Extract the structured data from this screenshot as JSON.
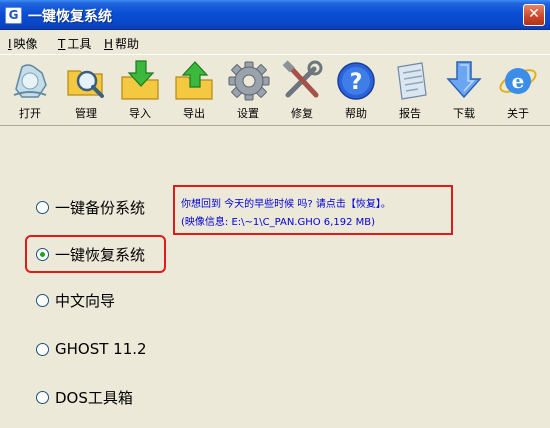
{
  "window": {
    "icon_letter": "G",
    "title": "一键恢复系统",
    "close_glyph": "✕"
  },
  "menu": [
    {
      "key": "I",
      "label": "映像"
    },
    {
      "key": "T",
      "label": "工具"
    },
    {
      "key": "H",
      "label": "帮助"
    }
  ],
  "toolbar": [
    {
      "label": "打开",
      "icon": "open-icon"
    },
    {
      "label": "管理",
      "icon": "manage-icon"
    },
    {
      "label": "导入",
      "icon": "import-icon"
    },
    {
      "label": "导出",
      "icon": "export-icon"
    },
    {
      "label": "设置",
      "icon": "settings-icon"
    },
    {
      "label": "修复",
      "icon": "repair-icon"
    },
    {
      "label": "帮助",
      "icon": "help-icon"
    },
    {
      "label": "报告",
      "icon": "report-icon"
    },
    {
      "label": "下载",
      "icon": "download-icon"
    },
    {
      "label": "关于",
      "icon": "about-icon"
    }
  ],
  "options": [
    {
      "label": "一键备份系统",
      "checked": false
    },
    {
      "label": "一键恢复系统",
      "checked": true
    },
    {
      "label": "中文向导",
      "checked": false
    },
    {
      "label": "GHOST 11.2",
      "checked": false
    },
    {
      "label": "DOS工具箱",
      "checked": false
    }
  ],
  "info": {
    "line1": "你想回到 今天的早些时候 吗? 请点击【恢复】。",
    "line2": "(映像信息: E:\\~1\\C_PAN.GHO   6,192 MB)"
  },
  "colors": {
    "titlebar": "#0a4fd6",
    "window_bg": "#ece9d8",
    "highlight": "#e01b1b",
    "info_text": "#0000d8"
  }
}
